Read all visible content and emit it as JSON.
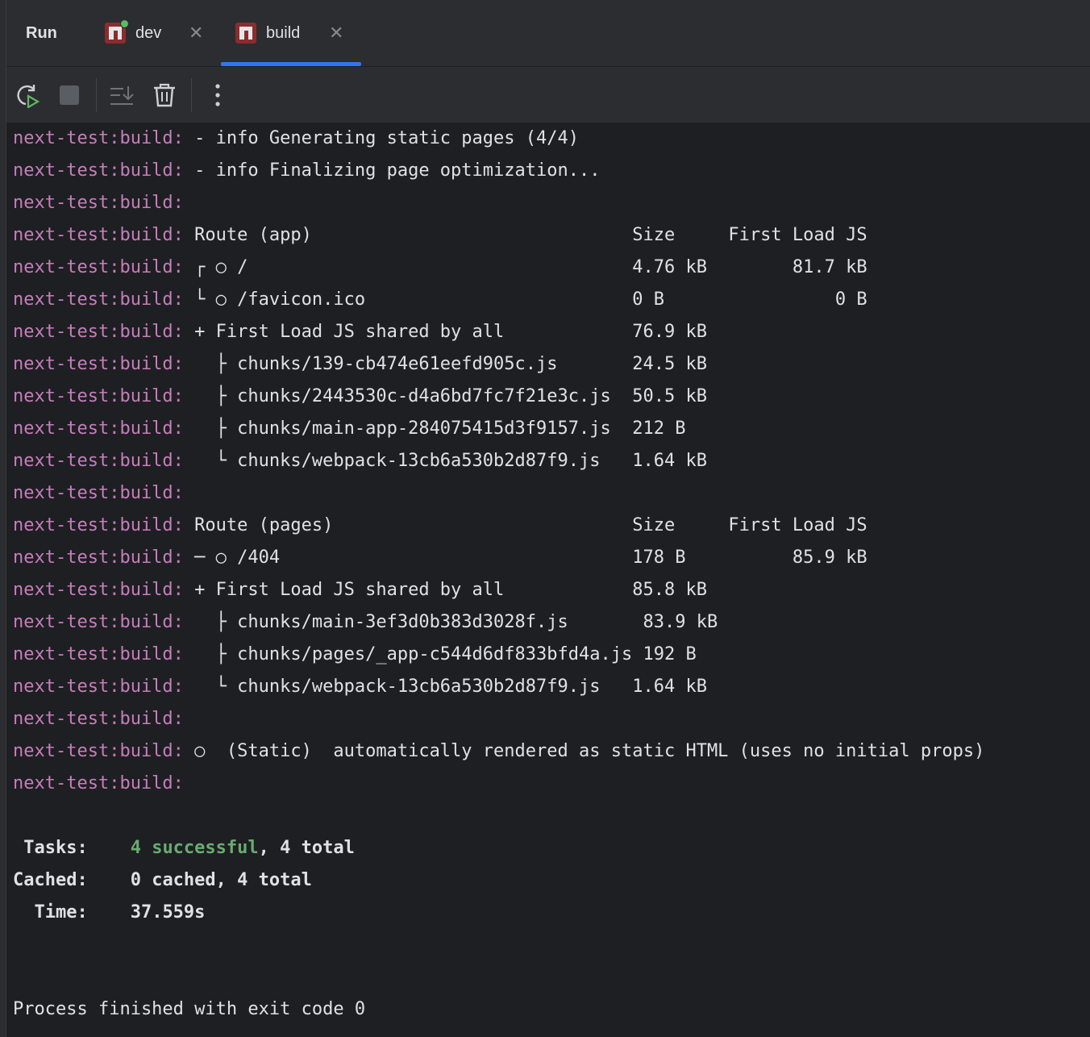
{
  "tabbar": {
    "run_label": "Run",
    "tabs": [
      {
        "title": "dev",
        "close": "✕"
      },
      {
        "title": "build",
        "close": "✕"
      }
    ]
  },
  "toolbar": {
    "icons": [
      "rerun-icon",
      "stop-icon",
      "scroll-to-end-icon",
      "clear-icon",
      "more-icon"
    ]
  },
  "console": {
    "prefix": "next-test:build:",
    "lines": [
      "- info Generating static pages (4/4)",
      "- info Finalizing page optimization...",
      "",
      "Route (app)                              Size     First Load JS",
      "┌ ○ /                                    4.76 kB        81.7 kB",
      "└ ○ /favicon.ico                         0 B                0 B",
      "+ First Load JS shared by all            76.9 kB",
      "  ├ chunks/139-cb474e61eefd905c.js       24.5 kB",
      "  ├ chunks/2443530c-d4a6bd7fc7f21e3c.js  50.5 kB",
      "  ├ chunks/main-app-284075415d3f9157.js  212 B",
      "  └ chunks/webpack-13cb6a530b2d87f9.js   1.64 kB",
      "",
      "Route (pages)                            Size     First Load JS",
      "─ ○ /404                                 178 B          85.9 kB",
      "+ First Load JS shared by all            85.8 kB",
      "  ├ chunks/main-3ef3d0b383d3028f.js       83.9 kB",
      "  ├ chunks/pages/_app-c544d6df833bfd4a.js 192 B",
      "  └ chunks/webpack-13cb6a530b2d87f9.js   1.64 kB",
      "",
      "○  (Static)  automatically rendered as static HTML (uses no initial props)",
      ""
    ],
    "summary": {
      "tasks_label": " Tasks:    ",
      "tasks_success": "4 successful",
      "tasks_rest": ", 4 total",
      "cached_label": "Cached:    ",
      "cached_value": "0 cached, 4 total",
      "time_label": "  Time:    ",
      "time_value": "37.559s"
    },
    "exit_message": "Process finished with exit code 0"
  },
  "colors": {
    "background": "#1e1f22",
    "panel": "#2b2d30",
    "prefix": "#c77dbb",
    "success": "#6aab73",
    "accent": "#3574f0"
  }
}
